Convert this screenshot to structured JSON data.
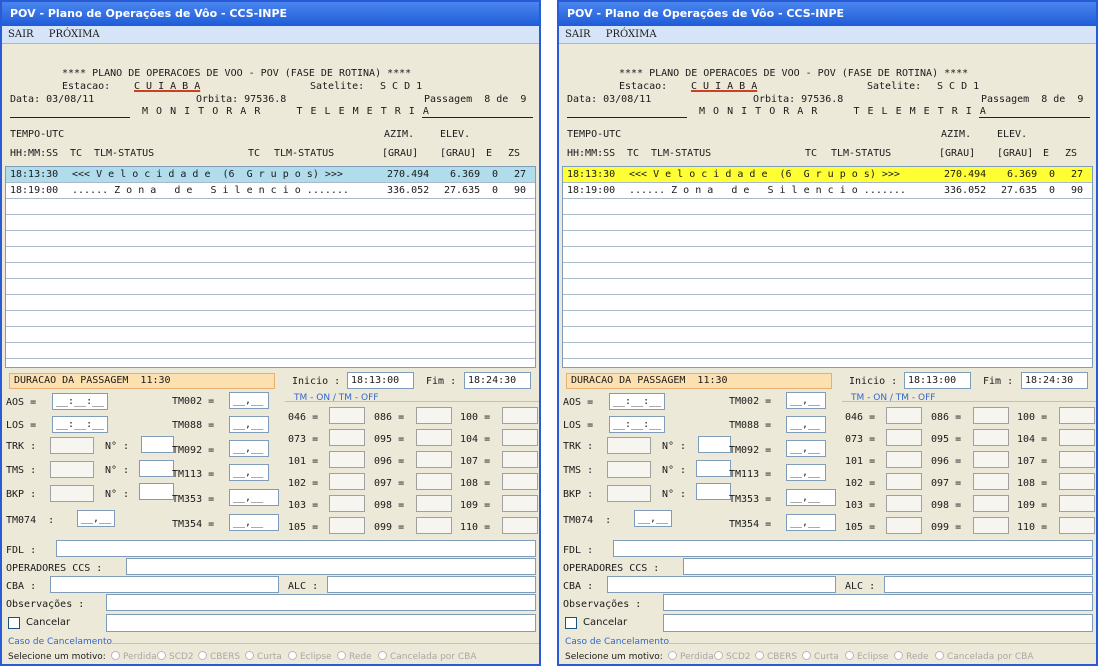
{
  "windows": [
    {
      "title": "POV - Plano de Operações de Vôo - CCS-INPE",
      "highlight_color": "#b0dcec",
      "menu": [
        "SAIR",
        "PRÓXIMA"
      ]
    },
    {
      "title": "POV - Plano de Operações de Vôo - CCS-INPE",
      "highlight_color": "#ffff33",
      "menu": [
        "SAIR",
        "PRÓXIMA"
      ]
    }
  ],
  "header": {
    "banner": "**** PLANO DE OPERACOES DE VOO - POV (FASE DE ROTINA) ****",
    "estacao_label": "Estacao:",
    "estacao_value": "C U I A B A",
    "satelite_label": "Satelite:",
    "satelite_value": "S C D 1",
    "data": "Data: 03/08/11",
    "orbita": "Orbita: 97536.8",
    "passagem": "Passagem  8 de  9",
    "section_title": "M O N I T O R A R     T E L E M E T R I A",
    "tempo_utc": "TEMPO-UTC",
    "azim": "AZIM.",
    "elev": "ELEV.",
    "col_hms": "HH:MM:SS",
    "col_tc": "TC",
    "col_tlm": "TLM-STATUS",
    "col_tc2": "TC",
    "col_tlm2": "TLM-STATUS",
    "col_grau": "[GRAU]",
    "col_grau2": "[GRAU]",
    "col_e": "E",
    "col_zs": "ZS"
  },
  "rows": [
    {
      "time": "18:13:30",
      "text": "<<< V e l o c i d a d e  (6  G r u p o s) >>>",
      "azim": "270.494",
      "elev": "6.369",
      "e": "0",
      "zs": "27"
    },
    {
      "time": "18:19:00",
      "text": "...... Z o n a   d e   S i l e n c i o .......",
      "azim": "336.052",
      "elev": "27.635",
      "e": "0",
      "zs": "90"
    }
  ],
  "form": {
    "duracao": "DURACAO DA PASSAGEM  11:30",
    "inicio_label": "Inicio :",
    "inicio_value": "18:13:00",
    "fim_label": "Fim :",
    "fim_value": "18:24:30",
    "aos": "AOS =",
    "los": "LOS =",
    "trk": "TRK :",
    "tms": "TMS :",
    "bkp": "BKP :",
    "n_label": "N° :",
    "tm074": "TM074  :",
    "time_mask": "__:__:__",
    "num_mask": "__,__",
    "tm_left": [
      "TM002 =",
      "TM088 =",
      "TM092 =",
      "TM113 =",
      "TM353 =",
      "TM354 ="
    ],
    "tm_on_off": "TM - ON / TM - OFF",
    "col1": [
      "046 =",
      "073 =",
      "101 =",
      "102 =",
      "103 =",
      "105 ="
    ],
    "col2": [
      "086 =",
      "095 =",
      "096 =",
      "097 =",
      "098 =",
      "099 ="
    ],
    "col3": [
      "100 =",
      "104 =",
      "107 =",
      "108 =",
      "109 =",
      "110 ="
    ],
    "fdl": "FDL :",
    "operadores": "OPERADORES CCS :",
    "cba": "CBA :",
    "alc": "ALC :",
    "observacoes": "Observações :",
    "cancelar": "Cancelar",
    "caso": "Caso de Cancelamento",
    "selecione": "Selecione um motivo:",
    "motivos": [
      "Perdida",
      "SCD2",
      "CBERS",
      "Curta",
      "Eclipse",
      "Rede",
      "Cancelada por CBA"
    ]
  }
}
